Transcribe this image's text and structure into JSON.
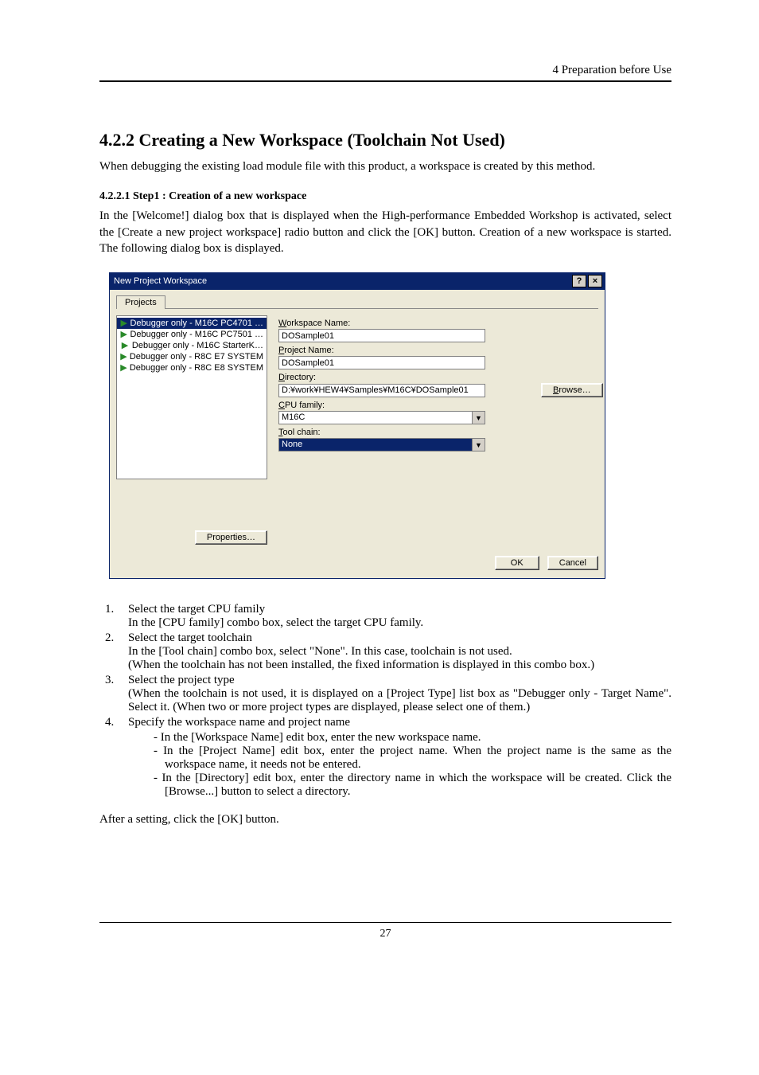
{
  "header": {
    "right": "4 Preparation before Use"
  },
  "section": {
    "title": "4.2.2 Creating a New Workspace (Toolchain Not Used)",
    "intro": "When debugging the existing load module file with this product, a workspace is created by this method.",
    "subhead": "4.2.2.1 Step1 : Creation of a new workspace",
    "subpara": "In the [Welcome!] dialog box that is displayed when the High-performance Embedded Workshop is activated, select the [Create a new project workspace] radio button and click the [OK] button. Creation of a new workspace is started. The following dialog box is displayed."
  },
  "dialog": {
    "title": "New Project Workspace",
    "help_glyph": "?",
    "close_glyph": "×",
    "tab": "Projects",
    "list_items": [
      "Debugger only - M16C PC4701 …",
      "Debugger only - M16C PC7501 …",
      "Debugger only - M16C StarterK…",
      "Debugger only - R8C E7 SYSTEM",
      "Debugger only - R8C E8 SYSTEM"
    ],
    "selected_index": 0,
    "labels": {
      "workspace_name": "Workspace Name:",
      "workspace_key": "W",
      "project_name": "Project Name:",
      "project_key": "P",
      "directory": "Directory:",
      "directory_key": "D",
      "cpu_family": "CPU family:",
      "cpu_key": "C",
      "tool_chain": "Tool chain:",
      "tool_key": "T",
      "browse": "Browse…",
      "browse_key": "B",
      "properties": "Properties…",
      "ok": "OK",
      "cancel": "Cancel"
    },
    "values": {
      "workspace_name": "DOSample01",
      "project_name": "DOSample01",
      "directory": "D:¥work¥HEW4¥Samples¥M16C¥DOSample01",
      "cpu_family": "M16C",
      "tool_chain": "None"
    }
  },
  "list": {
    "item1_a": "Select the target CPU family",
    "item1_b": "In the [CPU family] combo box, select the target CPU family.",
    "item2_a": "Select the target toolchain",
    "item2_b": "In the [Tool chain] combo box, select \"None\". In this case, toolchain is not used.",
    "item2_c": "(When the toolchain has not been installed, the fixed information is displayed in this combo box.)",
    "item3_a": "Select the project type",
    "item3_b": "(When the toolchain is not used, it is displayed on a [Project Type] list box as \"Debugger only - Target Name\". Select it. (When two or more project types are displayed, please select one of them.)",
    "item4_a": "Specify the workspace name and project name",
    "item4_b1": "In the [Workspace Name] edit box, enter the new workspace name.",
    "item4_b2": "In the [Project Name] edit box, enter the project name. When the project name is the same as the workspace name, it needs not be entered.",
    "item4_b3": "In the [Directory] edit box, enter the directory name in which the workspace will be created. Click the [Browse...] button to select a directory."
  },
  "after": "After a setting, click the [OK] button.",
  "page_number": "27"
}
